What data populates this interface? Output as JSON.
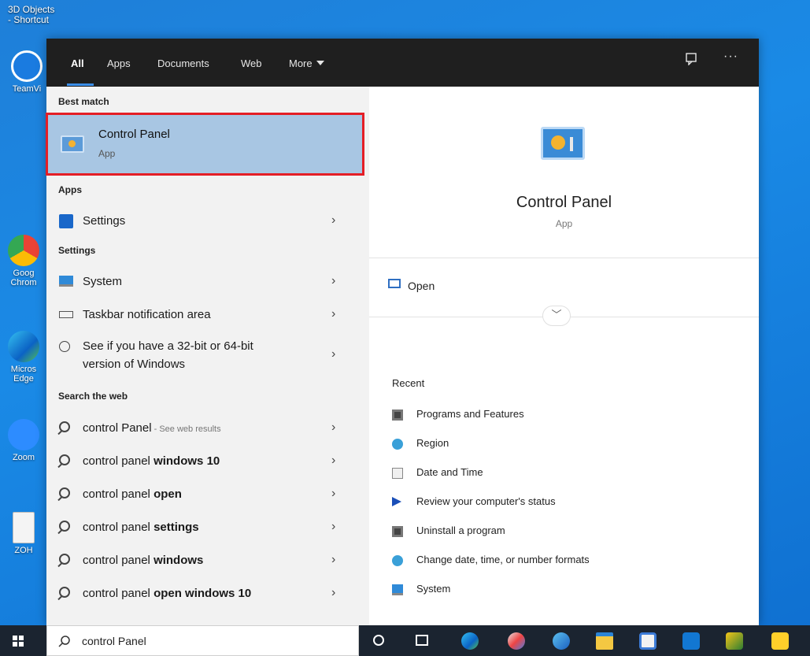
{
  "desktop": {
    "icon_labels": [
      "3D Objects - Shortcut",
      "TeamVi",
      "Goog Chrom",
      "Micros Edge",
      "Zoom",
      "ZOH"
    ]
  },
  "tabs": [
    {
      "label": "All",
      "active": true
    },
    {
      "label": "Apps"
    },
    {
      "label": "Documents"
    },
    {
      "label": "Web"
    },
    {
      "label": "More"
    }
  ],
  "top_icons": [
    "feedback-icon",
    "more-options-icon"
  ],
  "best_match": {
    "heading": "Best match",
    "title": "Control Panel",
    "subtitle": "App",
    "icon": "control-panel-icon"
  },
  "apps": {
    "heading": "Apps",
    "items": [
      {
        "label": "Settings",
        "icon": "gear-icon"
      }
    ]
  },
  "settings": {
    "heading": "Settings",
    "items": [
      {
        "label": "System",
        "icon": "monitor-icon"
      },
      {
        "label": "Taskbar notification area",
        "icon": "taskbar-icon"
      },
      {
        "label_line1": "See if you have a 32-bit or 64-bit",
        "label_line2": "version of Windows",
        "icon": "info-icon"
      }
    ]
  },
  "web": {
    "heading": "Search the web",
    "items": [
      {
        "prefix": "control Panel",
        "bold": "",
        "hint": " - See web results"
      },
      {
        "prefix": "control panel ",
        "bold": "windows 10"
      },
      {
        "prefix": "control panel ",
        "bold": "open"
      },
      {
        "prefix": "control panel ",
        "bold": "settings"
      },
      {
        "prefix": "control panel ",
        "bold": "windows"
      },
      {
        "prefix": "control panel ",
        "bold": "open windows 10"
      }
    ]
  },
  "preview": {
    "title": "Control Panel",
    "subtitle": "App",
    "open_label": "Open",
    "expand_symbol": "﹀",
    "recent_heading": "Recent",
    "recent": [
      {
        "label": "Programs and Features",
        "icon": "programs-icon"
      },
      {
        "label": "Region",
        "icon": "region-icon"
      },
      {
        "label": "Date and Time",
        "icon": "clock-icon"
      },
      {
        "label": "Review your computer's status",
        "icon": "flag-icon"
      },
      {
        "label": "Uninstall a program",
        "icon": "uninstall-icon"
      },
      {
        "label": "Change date, time, or number formats",
        "icon": "globe-icon"
      },
      {
        "label": "System",
        "icon": "monitor-icon"
      }
    ]
  },
  "taskbar": {
    "search_text": "control Panel",
    "pinned": [
      "task-view-icon",
      "timeline-icon",
      "edge-icon",
      "paint-icon",
      "browser-icon",
      "file-explorer-icon",
      "store-icon",
      "outlook-icon",
      "app-icon",
      "chrome-icon",
      "sticky-notes-icon"
    ]
  },
  "chevron": "›",
  "colors": {
    "accent": "#3b8ee8",
    "highlight": "#a8c6e3",
    "selection_border": "#e41e26",
    "topbar": "#1f1f1f",
    "taskbar": "#1b2430"
  }
}
